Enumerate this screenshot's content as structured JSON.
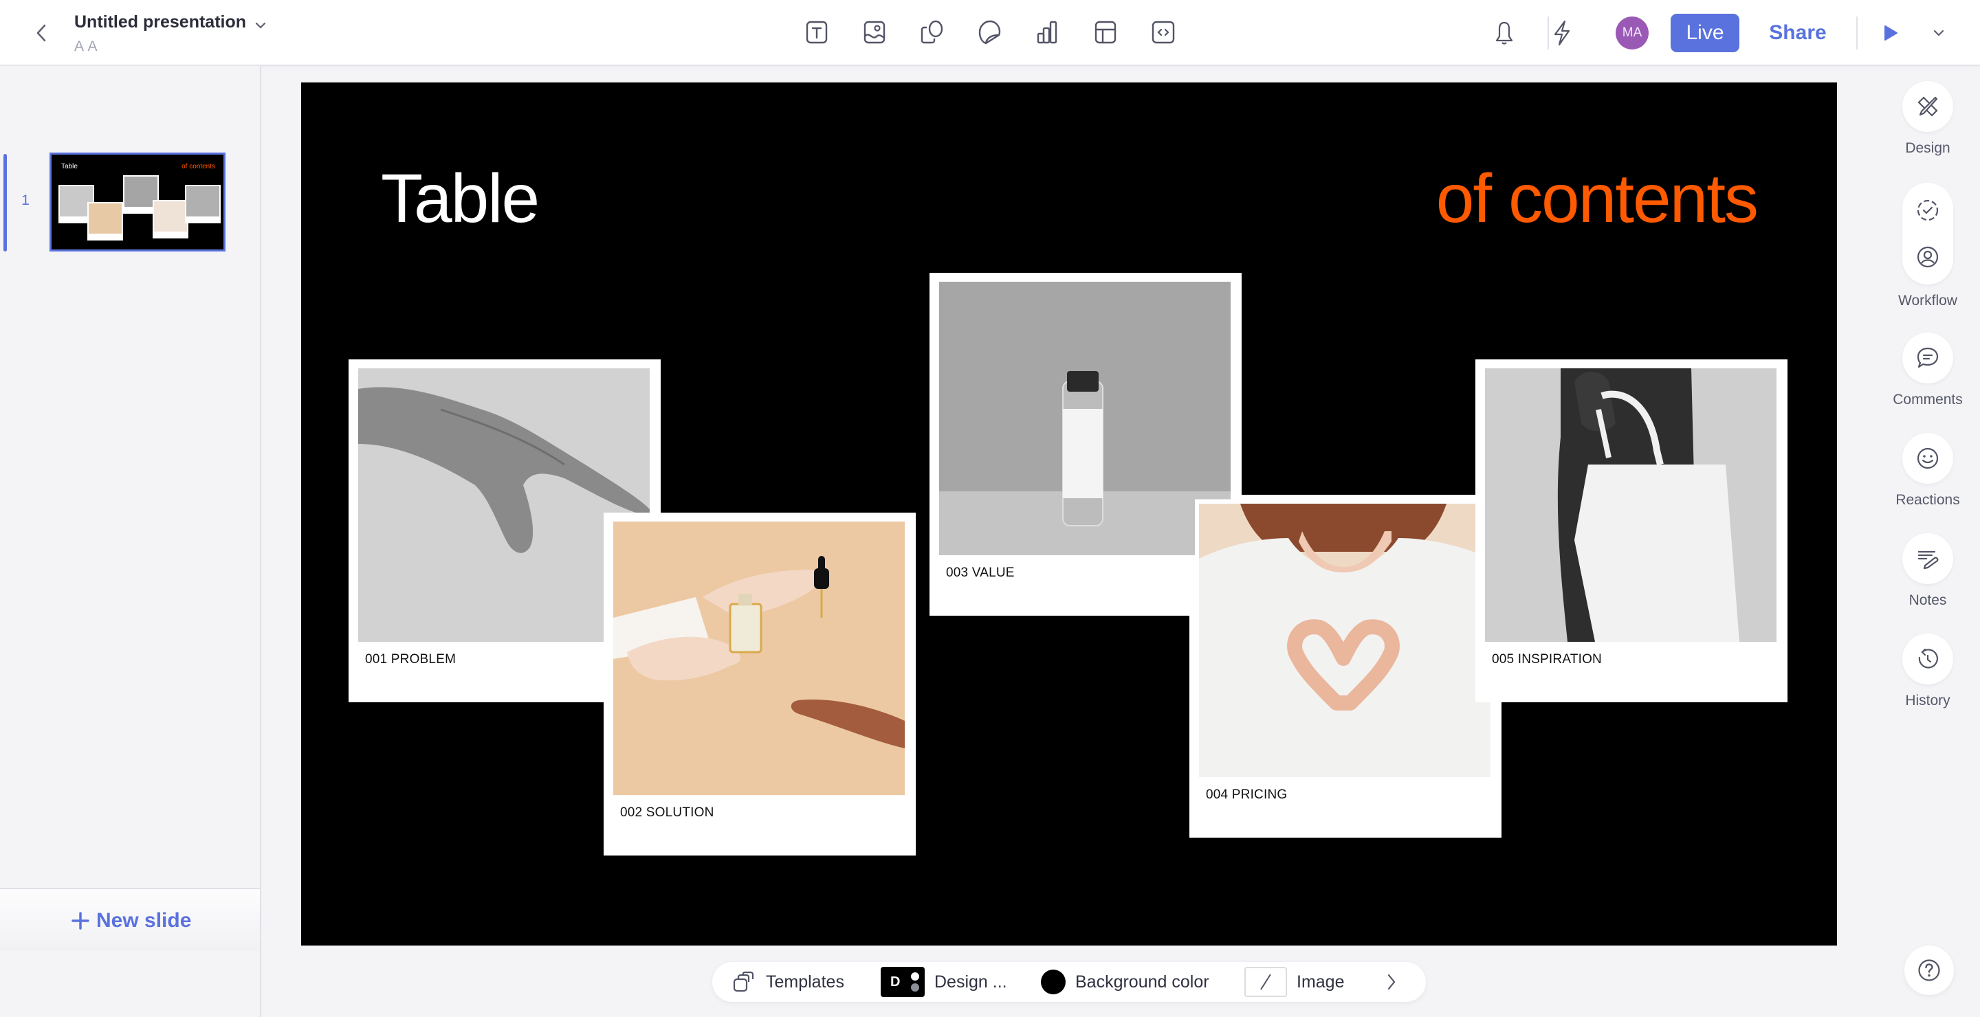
{
  "header": {
    "title": "Untitled presentation",
    "subtitle": "A A",
    "insert_tools": [
      {
        "name": "text-tool",
        "icon": "text-box-icon"
      },
      {
        "name": "image-tool",
        "icon": "image-icon"
      },
      {
        "name": "shape-tool",
        "icon": "shapes-icon"
      },
      {
        "name": "sticker-tool",
        "icon": "sticker-icon"
      },
      {
        "name": "chart-tool",
        "icon": "bar-chart-icon"
      },
      {
        "name": "table-tool",
        "icon": "table-icon"
      },
      {
        "name": "embed-tool",
        "icon": "code-embed-icon"
      }
    ],
    "avatar_initials": "MA",
    "live_label": "Live",
    "share_label": "Share"
  },
  "sidebar": {
    "slides": [
      {
        "number": "1",
        "title_left": "Table",
        "title_right": "of contents",
        "selected": true
      }
    ],
    "new_slide_label": "New slide"
  },
  "slide": {
    "title_left": "Table",
    "title_right": "of contents",
    "background_color": "#000000",
    "accent_color": "#ff5a00",
    "cards": [
      {
        "caption": "001 PROBLEM",
        "photo": "grayscale hand reaching"
      },
      {
        "caption": "002 SOLUTION",
        "photo": "hands passing serum bottle with dropper"
      },
      {
        "caption": "003 VALUE",
        "photo": "grayscale cosmetic bottle"
      },
      {
        "caption": "004 PRICING",
        "photo": "woman making heart with hands"
      },
      {
        "caption": "005 INSPIRATION",
        "photo": "grayscale person carrying tote bag"
      }
    ]
  },
  "right_rail": {
    "items": [
      {
        "label": "Design",
        "icon": "design-tools-icon"
      },
      {
        "label": "Workflow",
        "icon": "workflow-icon"
      },
      {
        "label": "Comments",
        "icon": "comment-icon"
      },
      {
        "label": "Reactions",
        "icon": "smiley-icon"
      },
      {
        "label": "Notes",
        "icon": "notes-icon"
      },
      {
        "label": "History",
        "icon": "history-icon"
      }
    ]
  },
  "bottom_toolbar": {
    "templates_label": "Templates",
    "design_label": "Design ...",
    "design_chip_letter": "D",
    "background_label": "Background color",
    "image_label": "Image"
  },
  "colors": {
    "brand": "#5a72de",
    "accent": "#ff5a00",
    "avatar": "#9b59b6"
  }
}
